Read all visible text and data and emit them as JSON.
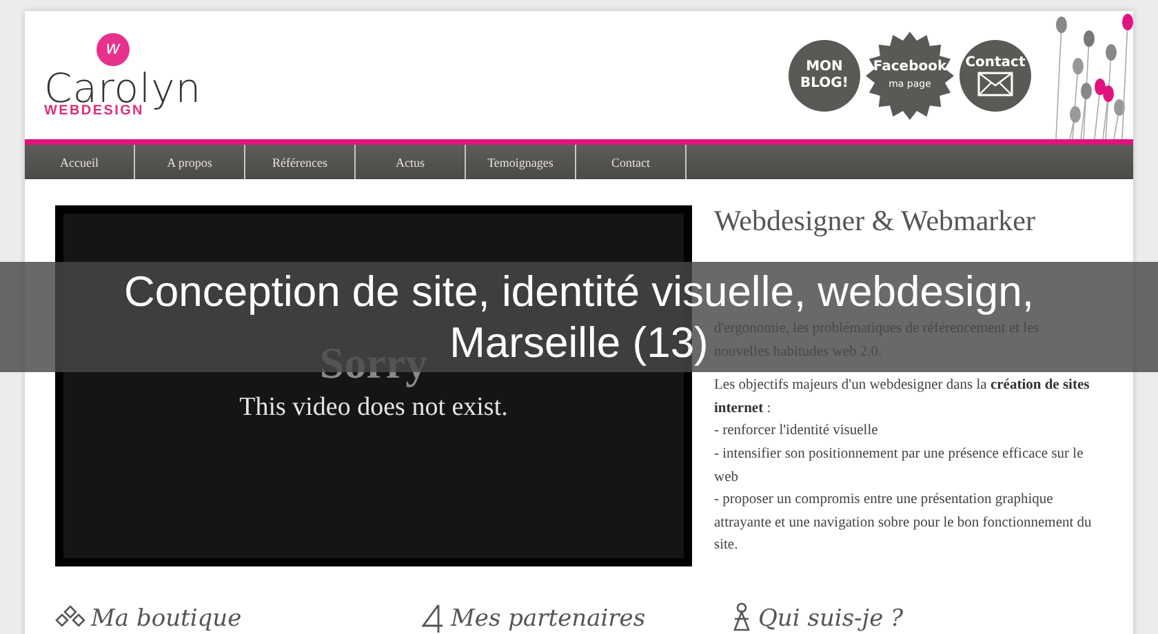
{
  "logo": {
    "mark": "w",
    "name": "Carolyn",
    "tagline": "WEBDESIGN"
  },
  "header_badges": [
    {
      "kind": "blog",
      "lines": [
        "MON",
        "BLOG!"
      ]
    },
    {
      "kind": "facebook",
      "lines": [
        "Facebook",
        "ma page"
      ]
    },
    {
      "kind": "contact",
      "lines": [
        "Contact"
      ]
    }
  ],
  "nav": [
    {
      "label": "Accueil"
    },
    {
      "label": "A propos"
    },
    {
      "label": "Références"
    },
    {
      "label": "Actus"
    },
    {
      "label": "Temoignages"
    },
    {
      "label": "Contact"
    }
  ],
  "video": {
    "title": "Sorry",
    "message": "This video does not exist."
  },
  "intro": {
    "heading": "Webdesigner & Webmarker",
    "visible_lines": [
      "d'ergonomie, les problématiques de référencement et les",
      "nouvelles habitudes web 2.0."
    ],
    "objectives": "Les objectifs majeurs d'un webdesigner dans la **création de sites internet** :",
    "bullets": [
      "- renforcer l'identité visuelle",
      "- intensifier son positionnement par une présence efficace sur le web",
      "- proposer un compromis entre une présentation graphique attrayante et une navigation sobre pour le bon fonctionnement du site."
    ]
  },
  "sections": [
    {
      "kind": "shop",
      "title": "Ma boutique"
    },
    {
      "kind": "partners",
      "title": "Mes partenaires"
    },
    {
      "kind": "about",
      "title": "Qui suis-je ?"
    }
  ],
  "caption": {
    "lines": [
      "Conception de site, identité visuelle, webdesign,",
      "Marseille (13)"
    ]
  }
}
